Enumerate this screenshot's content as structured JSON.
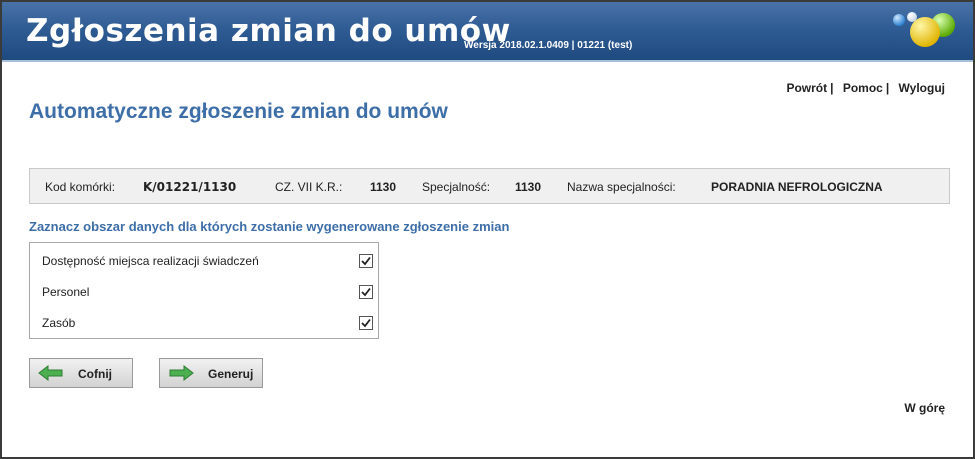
{
  "header": {
    "app_title": "Zgłoszenia zmian do umów",
    "version": "Wersja 2018.02.1.0409 | 01221 (test)"
  },
  "toplinks": {
    "back": "Powrót",
    "help": "Pomoc",
    "logout": "Wyloguj",
    "separator": "|"
  },
  "page": {
    "title": "Automatyczne zgłoszenie zmian do umów"
  },
  "infobar": {
    "kod_label": "Kod komórki:",
    "kod_value": "K/01221/1130",
    "cz_label": "CZ. VII K.R.:",
    "cz_value": "1130",
    "spec_label": "Specjalność:",
    "spec_value": "1130",
    "nazwa_label": "Nazwa specjalności:",
    "nazwa_value": "PORADNIA NEFROLOGICZNA"
  },
  "section": {
    "title": "Zaznacz obszar danych dla których zostanie wygenerowane zgłoszenie zmian"
  },
  "options": [
    {
      "label": "Dostępność miejsca realizacji świadczeń",
      "checked": true
    },
    {
      "label": "Personel",
      "checked": true
    },
    {
      "label": "Zasób",
      "checked": true
    }
  ],
  "buttons": {
    "back": "Cofnij",
    "generate": "Generuj"
  },
  "footer": {
    "to_top": "W górę"
  },
  "colors": {
    "header_blue": "#2f5c94",
    "title_blue": "#3d6ea8",
    "arrow_green": "#4caf50"
  }
}
